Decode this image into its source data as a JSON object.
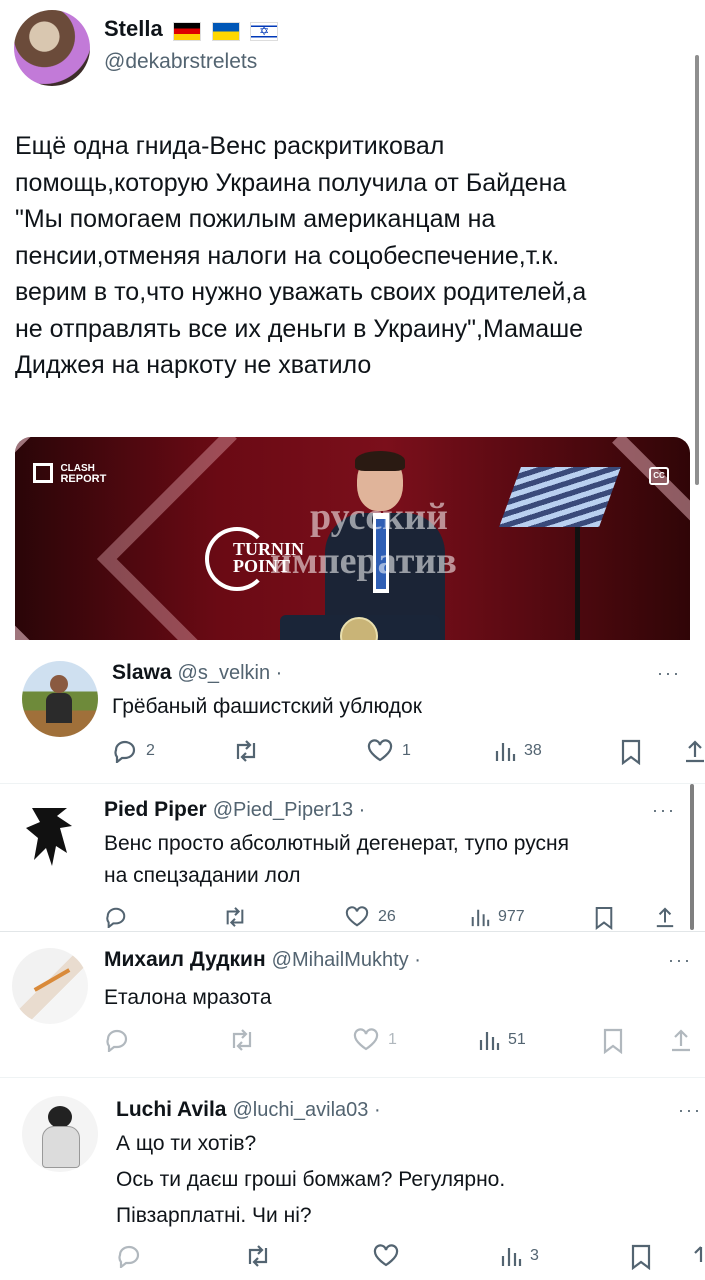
{
  "post": {
    "author_name": "Stella",
    "handle": "@dekabrstrelets",
    "text": "Ещё одна гнида-Венс раскритиковал\nпомощь,которую Украина получила от Байдена\n\"Мы помогаем пожилым американцам на\nпенсии,отменяя налоги на соцобеспечение,т.к.\nверим в то,что нужно уважать своих родителей,а\nне отправлять все их деньги в Украину\",Мамаше\nДиджея на наркоту не хватило"
  },
  "video": {
    "clash_report_line1": "CLASH",
    "clash_report_line2": "REPORT",
    "cc_label": "CC",
    "turning_point_line1": "TURNIN",
    "turning_point_line2": "POINT",
    "watermark_line1": "русский",
    "watermark_line2": "императив"
  },
  "replies": [
    {
      "name": "Slawa",
      "handle": "@s_velkin ·",
      "text": "Грёбаный фашистский ублюдок",
      "replies": "2",
      "reposts": "",
      "likes": "1",
      "views": "38"
    },
    {
      "name": "Pied Piper",
      "handle": "@Pied_Piper13 ·",
      "text": "Венс просто абсолютный дегенерат, тупо русня\nна спецзадании лол",
      "replies": "",
      "reposts": "",
      "likes": "26",
      "views": "977"
    },
    {
      "name": "Михаил Дудкин",
      "handle": "@MihailMukhty ·",
      "text": "Еталона мразота",
      "replies": "",
      "reposts": "",
      "likes": "1",
      "views": "51"
    },
    {
      "name": "Luchi Avila",
      "handle": "@luchi_avila03 ·",
      "text": "А що ти хотів?\nОсь ти даєш гроші бомжам? Регулярно.\nПівзарплатні. Чи ні?",
      "replies": "",
      "reposts": "",
      "likes": "",
      "views": "3"
    }
  ],
  "more_label": "···"
}
